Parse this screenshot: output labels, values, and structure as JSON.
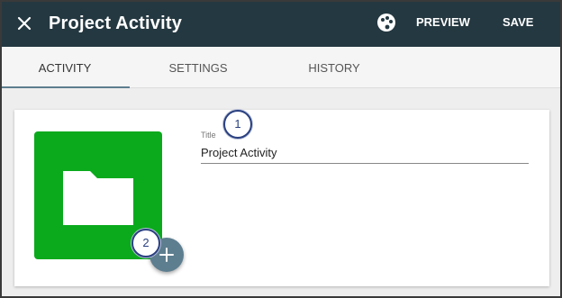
{
  "header": {
    "title": "Project Activity",
    "preview_label": "PREVIEW",
    "save_label": "SAVE",
    "close_icon": "close-icon",
    "palette_icon": "palette-icon"
  },
  "tabs": [
    {
      "label": "ACTIVITY",
      "active": true
    },
    {
      "label": "SETTINGS",
      "active": false
    },
    {
      "label": "HISTORY",
      "active": false
    }
  ],
  "form": {
    "title_label": "Title",
    "title_value": "Project Activity"
  },
  "icon_tile": {
    "color": "#0aaa1c",
    "icon": "folder-icon"
  },
  "add_button": {
    "icon": "plus-icon",
    "color": "#5d7e8f"
  },
  "callouts": [
    "1",
    "2"
  ],
  "colors": {
    "header_bg": "#243841",
    "accent": "#5d7e8f",
    "callout": "#2a4080"
  }
}
